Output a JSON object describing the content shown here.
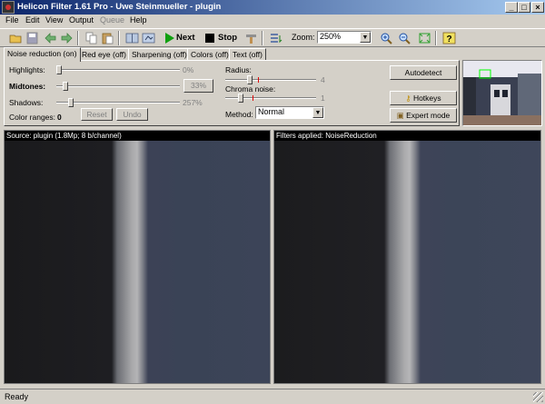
{
  "window": {
    "title": "Helicon Filter 1.61 Pro - Uwe Steinmueller - plugin",
    "minimize": "_",
    "maximize": "□",
    "close": "×"
  },
  "menu": [
    "File",
    "Edit",
    "View",
    "Output",
    "Queue",
    "Help"
  ],
  "toolbar": {
    "next_label": "Next",
    "stop_label": "Stop",
    "zoom_label": "Zoom:",
    "zoom_value": "250%",
    "icons": [
      "open-icon",
      "save-icon",
      "back-arrow-icon",
      "forward-arrow-icon",
      "copy-icon",
      "paste-icon",
      "compare-icon",
      "export-icon",
      "play-icon",
      "stop-icon",
      "brush-icon",
      "batch-icon",
      "zoom-in-icon",
      "zoom-out-icon",
      "fit-icon",
      "help-icon"
    ]
  },
  "tabs": [
    "Noise reduction (on)",
    "Red eye (off)",
    "Sharpening (off)",
    "Colors (off)",
    "Text (off)"
  ],
  "noise_reduction": {
    "highlights_label": "Highlights:",
    "highlights_value": "0%",
    "midtones_label": "Midtones:",
    "midtones_value": "33%",
    "shadows_label": "Shadows:",
    "shadows_value": "257%",
    "color_ranges_label": "Color ranges:",
    "color_ranges_value": "0",
    "reset_label": "Reset",
    "undo_label": "Undo",
    "radius_label": "Radius:",
    "radius_value": "4",
    "chroma_label": "Chroma noise:",
    "chroma_value": "1",
    "method_label": "Method:",
    "method_value": "Normal",
    "autodetect_label": "Autodetect",
    "hotkeys_label": "Hotkeys",
    "expert_label": "Expert mode",
    "slider_levels": {
      "highlights": 0.0,
      "midtones": 0.05,
      "shadows": 0.1,
      "radius": 0.25,
      "chroma": 0.15
    }
  },
  "source_pane": {
    "header": "Source: plugin (1.8Mp; 8 b/channel)"
  },
  "result_pane": {
    "header": "Filters applied: NoiseReduction"
  },
  "status": {
    "text": "Ready"
  }
}
